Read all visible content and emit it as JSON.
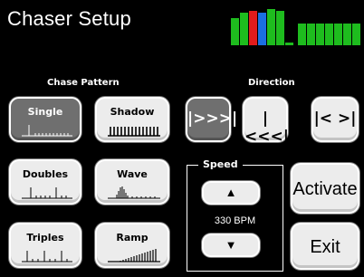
{
  "header": {
    "title": "Chaser Setup"
  },
  "level_meter": {
    "colors": {
      "green": "#1ebc1e",
      "red": "#e11b1b",
      "blue": "#1b6fe1"
    },
    "bar_levels": [
      0.75,
      0.9,
      0.95,
      0.9,
      1.0,
      0.95,
      0.08,
      0.6,
      0.6,
      0.6,
      0.6,
      0.6,
      0.6,
      0.6
    ]
  },
  "chase_pattern": {
    "label": "Chase Pattern",
    "options": [
      {
        "label": "Single",
        "active": true
      },
      {
        "label": "Shadow",
        "active": false
      },
      {
        "label": "Doubles",
        "active": false
      },
      {
        "label": "Wave",
        "active": false
      },
      {
        "label": "Triples",
        "active": false
      },
      {
        "label": "Ramp",
        "active": false
      }
    ]
  },
  "direction": {
    "label": "Direction",
    "options": [
      {
        "glyph": "|>>>|",
        "icon": "forward-icon",
        "active": true
      },
      {
        "glyph": "|<<<|",
        "icon": "reverse-icon",
        "active": false
      },
      {
        "glyph": "|< >|",
        "icon": "bounce-icon",
        "active": false
      }
    ]
  },
  "speed": {
    "label": "Speed",
    "value_text": "330 BPM",
    "up_icon": "up-arrow-icon",
    "down_icon": "down-arrow-icon",
    "up_glyph": "▲",
    "down_glyph": "▼"
  },
  "actions": {
    "activate_label": "Activate",
    "exit_label": "Exit"
  }
}
